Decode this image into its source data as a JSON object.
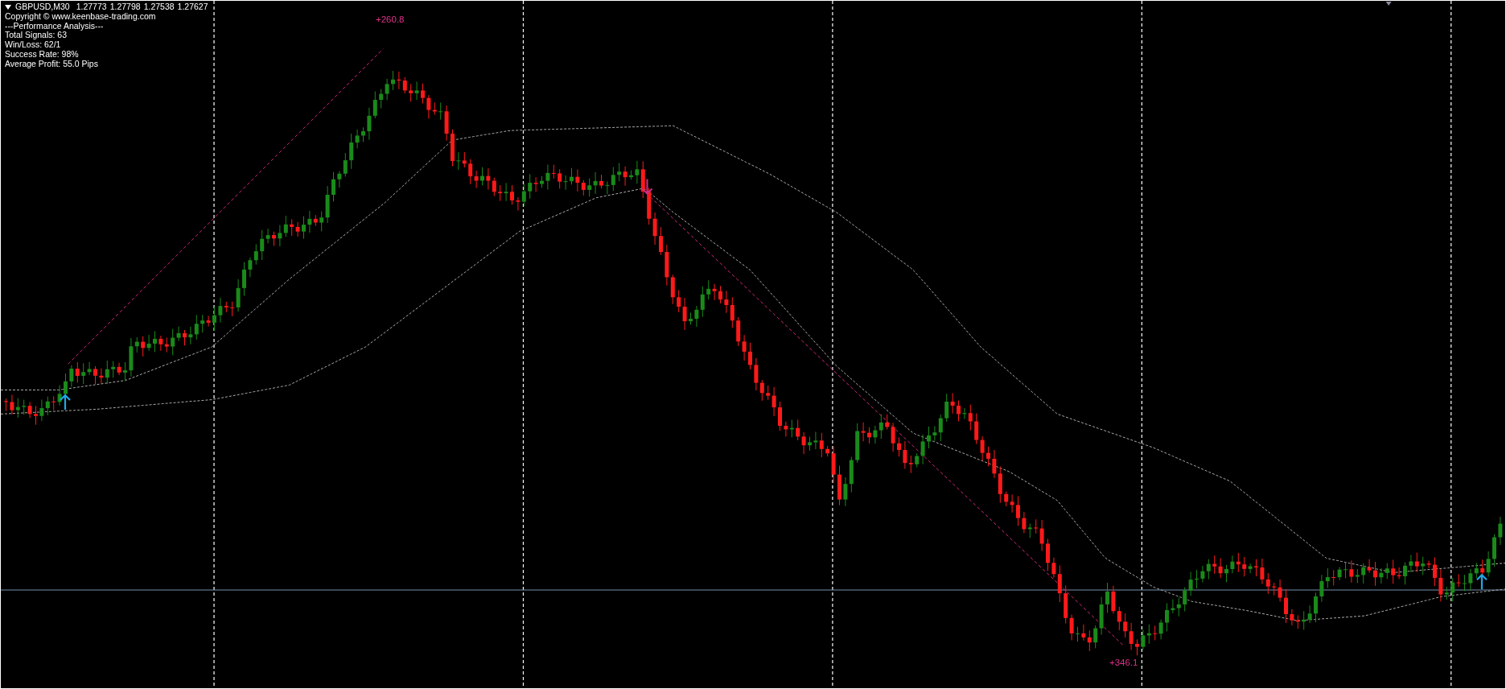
{
  "header": {
    "symbol": "GBPUSD,M30",
    "quotes": [
      "1.27773",
      "1.27798",
      "1.27538",
      "1.27627"
    ]
  },
  "info_lines": [
    "Copyright © www.keenbase-trading.com",
    "---Performance Analysis---",
    "Total Signals: 63",
    "Win/Loss: 62/1",
    "Success Rate: 98%",
    "Average Profit: 55.0 Pips"
  ],
  "profit_labels": [
    "+260.8",
    "+346.1"
  ]
}
